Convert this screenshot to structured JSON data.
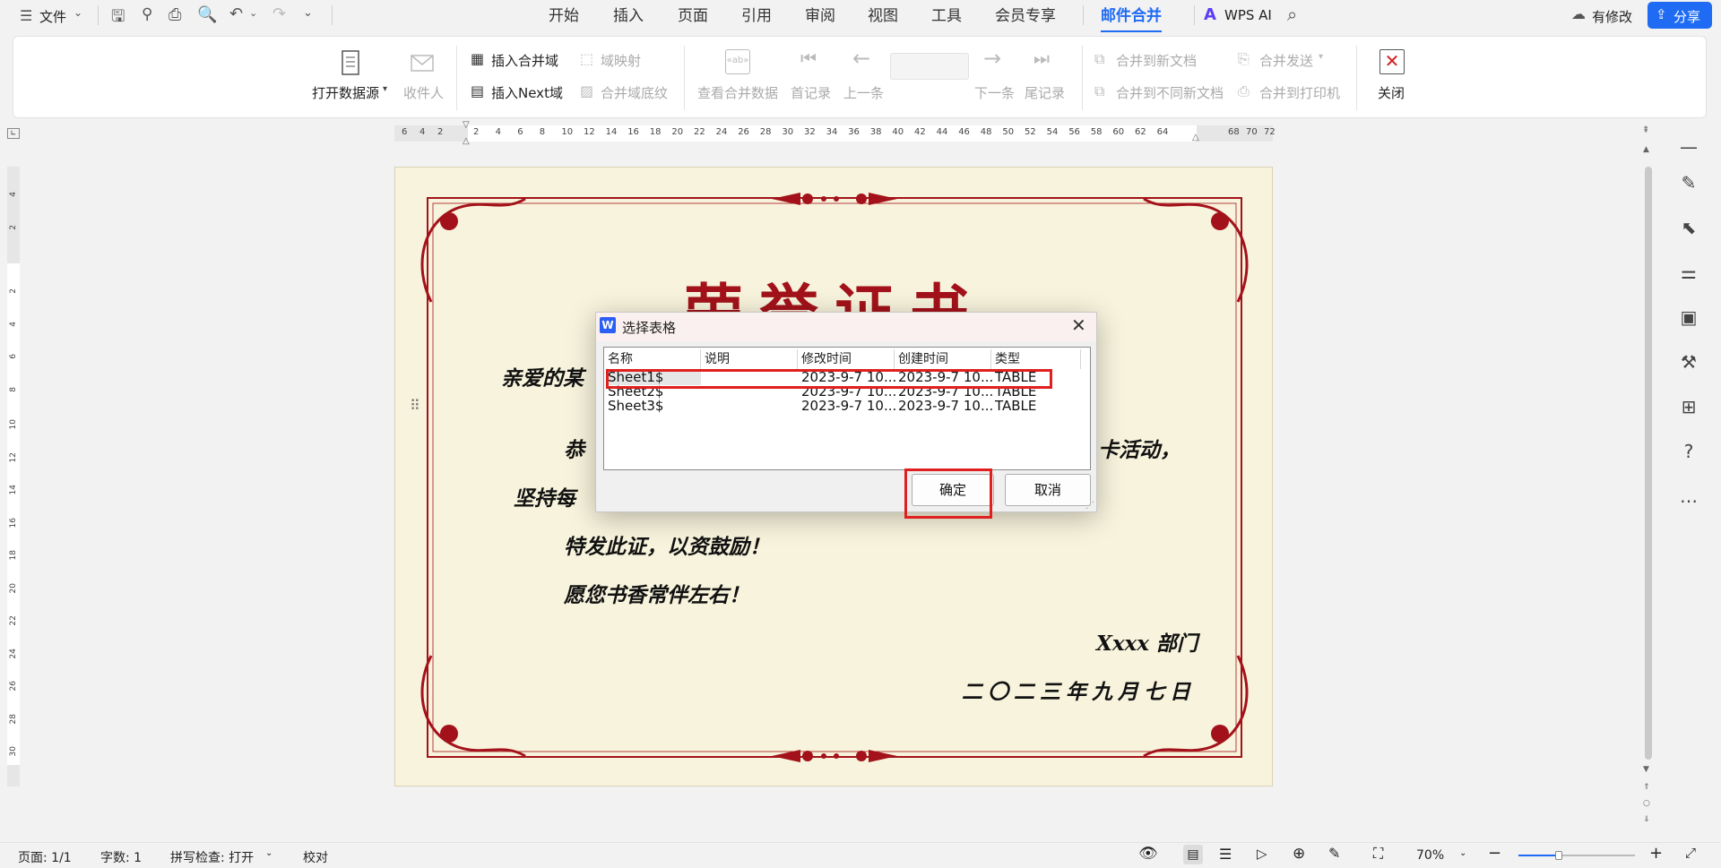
{
  "topbar": {
    "file_label": "文件",
    "tabs": [
      "开始",
      "插入",
      "页面",
      "引用",
      "审阅",
      "视图",
      "工具",
      "会员专享",
      "邮件合并"
    ],
    "active_tab": "邮件合并",
    "wps_ai": "WPS AI",
    "modify_label": "有修改",
    "share_label": "分享"
  },
  "ribbon": {
    "open_source": "打开数据源",
    "recipients": "收件人",
    "insert_merge_field": "插入合并域",
    "insert_next_field": "插入Next域",
    "field_mapping": "域映射",
    "merge_field_shading": "合并域底纹",
    "view_merged_data": "查看合并数据",
    "first_record": "首记录",
    "prev_record": "上一条",
    "next_record": "下一条",
    "last_record": "尾记录",
    "merge_new_doc": "合并到新文档",
    "merge_diff_doc": "合并到不同新文档",
    "merge_send": "合并发送",
    "merge_printer": "合并到打印机",
    "close": "关闭"
  },
  "ruler": {
    "ticks": [
      "6",
      "4",
      "2",
      "2",
      "4",
      "6",
      "8",
      "10",
      "12",
      "14",
      "16",
      "18",
      "20",
      "22",
      "24",
      "26",
      "28",
      "30",
      "32",
      "34",
      "36",
      "38",
      "40",
      "42",
      "44",
      "46",
      "48",
      "50",
      "52",
      "54",
      "56",
      "58",
      "60",
      "62",
      "64",
      "68",
      "70",
      "72"
    ],
    "vticks": [
      "4",
      "2",
      "2",
      "4",
      "6",
      "8",
      "10",
      "12",
      "14",
      "16",
      "18",
      "20",
      "22",
      "24",
      "26",
      "28",
      "30"
    ]
  },
  "certificate": {
    "title": "荣誉证书",
    "greeting": "亲爱的某",
    "line1_start": "恭",
    "line1_end": "卡活动，",
    "line2_start": "坚持每",
    "line3": "特发此证，以资鼓励！",
    "line4": "愿您书香常伴左右！",
    "dept": "Xxxx 部门",
    "date": "二〇二三年九月七日"
  },
  "dialog": {
    "title": "选择表格",
    "columns": [
      "名称",
      "说明",
      "修改时间",
      "创建时间",
      "类型"
    ],
    "rows": [
      {
        "name": "Sheet1$",
        "desc": "",
        "modified": "2023-9-7 10...",
        "created": "2023-9-7 10...",
        "type": "TABLE"
      },
      {
        "name": "Sheet2$",
        "desc": "",
        "modified": "2023-9-7 10...",
        "created": "2023-9-7 10...",
        "type": "TABLE"
      },
      {
        "name": "Sheet3$",
        "desc": "",
        "modified": "2023-9-7 10...",
        "created": "2023-9-7 10...",
        "type": "TABLE"
      }
    ],
    "ok": "确定",
    "cancel": "取消"
  },
  "status": {
    "page": "页面: 1/1",
    "words": "字数: 1",
    "spell": "拼写检查: 打开",
    "proof": "校对",
    "zoom": "70%"
  },
  "colors": {
    "accent": "#1f6bf4",
    "highlight_red": "#e0201e",
    "certificate_red": "#a3121a"
  }
}
